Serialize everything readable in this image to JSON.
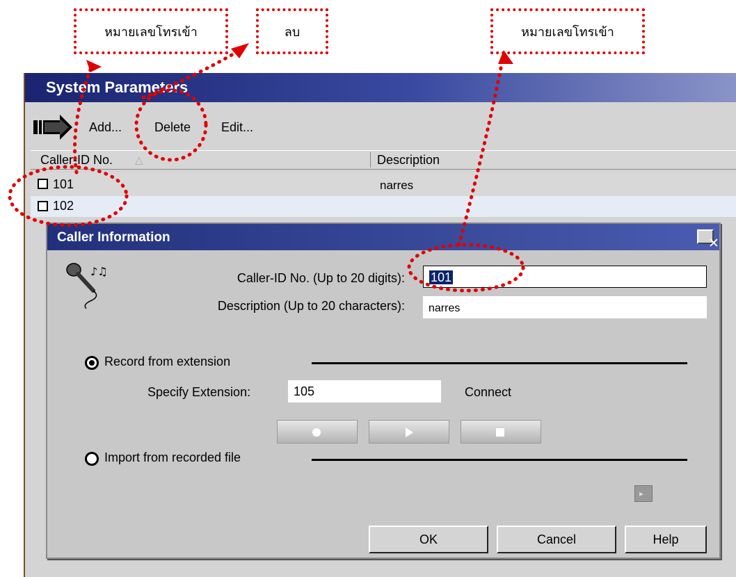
{
  "annotations": {
    "incoming_left": "หมายเลขโทรเข้า",
    "delete": "ลบ",
    "incoming_right": "หมายเลขโทรเข้า"
  },
  "window": {
    "title": "System Parameters"
  },
  "toolbar": {
    "add_label": "Add...",
    "delete_label": "Delete",
    "edit_label": "Edit..."
  },
  "list": {
    "columns": [
      "Caller-ID No.",
      "Description"
    ],
    "rows": [
      {
        "caller_id": "101",
        "description": "narres"
      },
      {
        "caller_id": "102",
        "description": ""
      }
    ]
  },
  "dialog": {
    "title": "Caller Information",
    "close_glyph": "✕",
    "caller_id_label": "Caller-ID No. (Up to 20 digits):",
    "caller_id_value": "101",
    "description_label": "Description (Up to 20 characters):",
    "description_value": "narres",
    "record_option": "Record from extension",
    "specify_ext_label": "Specify Extension:",
    "specify_ext_value": "105",
    "connect_label": "Connect",
    "import_option": "Import from recorded file",
    "ok": "OK",
    "cancel": "Cancel",
    "help": "Help"
  },
  "colors": {
    "annotation": "#e00000",
    "titlebar": "#1a2470",
    "selection": "#0a246a"
  }
}
